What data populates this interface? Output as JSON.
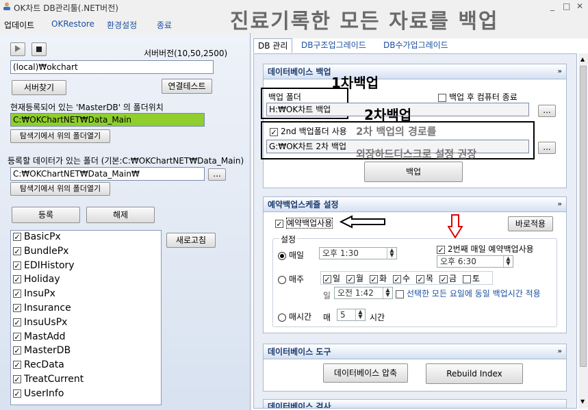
{
  "window": {
    "title": "OK차트 DB관리툴(.NET버전)",
    "banner": "진료기록한 모든 자료를 백업",
    "minimize": "_",
    "maximize": "□",
    "close": "✕"
  },
  "menu": {
    "update": "업데이트",
    "okrestore": "OKRestore",
    "settings": "환경설정",
    "exit": "종료"
  },
  "left": {
    "server_version_label": "서버버전(10,50,2500)",
    "server_value": "(local)₩okchart",
    "find_server": "서버찾기",
    "connect_test": "연결테스트",
    "masterdb_label": "현재등록되어 있는 'MasterDB' 의 폴더위치",
    "masterdb_path": "C:₩OKChartNET₩Data_Main",
    "open_explorer1": "탐색기에서 위의 폴더열기",
    "data_folder_label": "등록할 데이터가 있는 폴더 (기본:C:₩OKChartNET₩Data_Main)",
    "data_folder_path": "C:₩OKChartNET₩Data_Main₩",
    "browse": "...",
    "open_explorer2": "탐색기에서 위의 폴더열기",
    "register": "등록",
    "unregister": "해제",
    "refresh": "새로고침",
    "databases": [
      "BasicPx",
      "BundlePx",
      "EDIHistory",
      "Holiday",
      "InsuPx",
      "Insurance",
      "InsuUsPx",
      "MastAdd",
      "MasterDB",
      "RecData",
      "TreatCurrent",
      "UserInfo"
    ]
  },
  "tabs": [
    "DB 관리",
    "DB구조업그레이드",
    "DB수가업그레이드"
  ],
  "backup": {
    "header": "데이터베이스 백업",
    "collapse": "»",
    "note1": "1차백업",
    "folder_label": "백업 폴더",
    "shutdown_label": "백업 후 컴퓨터 종료",
    "folder_path": "H:₩OK차트 백업",
    "browse": "...",
    "note2": "2차백업",
    "second_label": "2nd 백업폴더 사용",
    "second_hint1": "2차 백업의 경로를",
    "second_path": "G:₩OK차트 2차 백업",
    "second_hint2": "외장하드디스크로 설정 권장",
    "browse2": "...",
    "backup_button": "백업"
  },
  "schedule": {
    "header": "예약백업스케쥴 설정",
    "collapse": "»",
    "use_label": "예약백업사용",
    "apply_now": "바로적용",
    "settings_group": "설정",
    "daily": "매일",
    "daily_time": "오후 1:30",
    "second_daily": "2번째 매일 예약백업사용",
    "second_time": "오후 6:30",
    "weekly": "매주",
    "days": [
      "일",
      "월",
      "화",
      "수",
      "목",
      "금",
      "토"
    ],
    "days_checked": [
      true,
      true,
      true,
      true,
      true,
      true,
      false
    ],
    "weekly_time_prefix": "일",
    "weekly_time": "오전 1:42",
    "same_time_label": "선택한 모든 요일에 동일 백업시간 적용",
    "hourly": "매시간",
    "hourly_prefix": "매",
    "hourly_value": "5",
    "hourly_suffix": "시간"
  },
  "tools": {
    "header": "데이터베이스 도구",
    "collapse": "»",
    "compress": "데이터베이스 압축",
    "rebuild": "Rebuild Index",
    "next_header": "데이터베이스 검사"
  }
}
